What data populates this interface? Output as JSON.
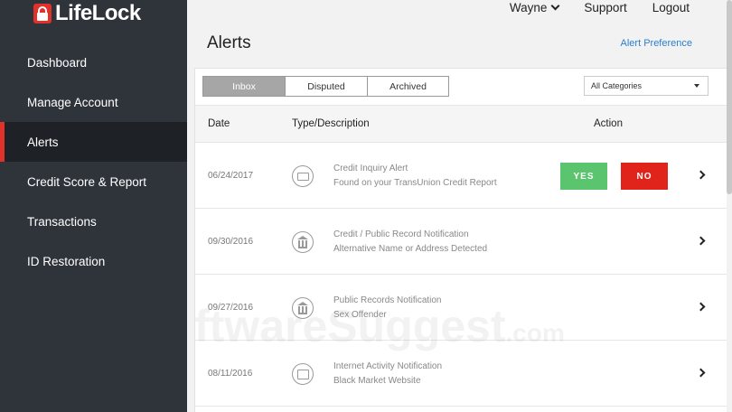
{
  "brand": {
    "name": "LifeLock"
  },
  "topnav": {
    "user": "Wayne",
    "support": "Support",
    "logout": "Logout"
  },
  "sidebar": {
    "items": [
      {
        "label": "Dashboard"
      },
      {
        "label": "Manage Account"
      },
      {
        "label": "Alerts",
        "active": true
      },
      {
        "label": "Credit Score & Report"
      },
      {
        "label": "Transactions"
      },
      {
        "label": "ID Restoration"
      }
    ]
  },
  "page": {
    "title": "Alerts",
    "preference_link": "Alert Preference"
  },
  "tabs": [
    {
      "label": "Inbox",
      "active": true
    },
    {
      "label": "Disputed"
    },
    {
      "label": "Archived"
    }
  ],
  "filter": {
    "selected": "All Categories"
  },
  "table": {
    "headers": {
      "date": "Date",
      "type": "Type/Description",
      "action": "Action"
    },
    "rows": [
      {
        "date": "06/24/2017",
        "icon": "credit-card-icon",
        "title": "Credit Inquiry Alert",
        "desc": "Found on your TransUnion Credit Report",
        "yes": "YES",
        "no": "NO"
      },
      {
        "date": "09/30/2016",
        "icon": "bank-icon",
        "title": "Credit / Public Record Notification",
        "desc": "Alternative Name or Address Detected"
      },
      {
        "date": "09/27/2016",
        "icon": "bank-icon",
        "title": "Public Records Notification",
        "desc": "Sex Offender"
      },
      {
        "date": "08/11/2016",
        "icon": "web-icon",
        "title": "Internet Activity Notification",
        "desc": "Black Market Website"
      }
    ]
  },
  "watermark": {
    "text": "ftwareSuggest",
    "suffix": ".com"
  },
  "colors": {
    "accent": "#e0312a",
    "sidebar": "#2f343b",
    "yes": "#5bc46e",
    "no": "#e0231b",
    "link": "#2a7fcf"
  }
}
